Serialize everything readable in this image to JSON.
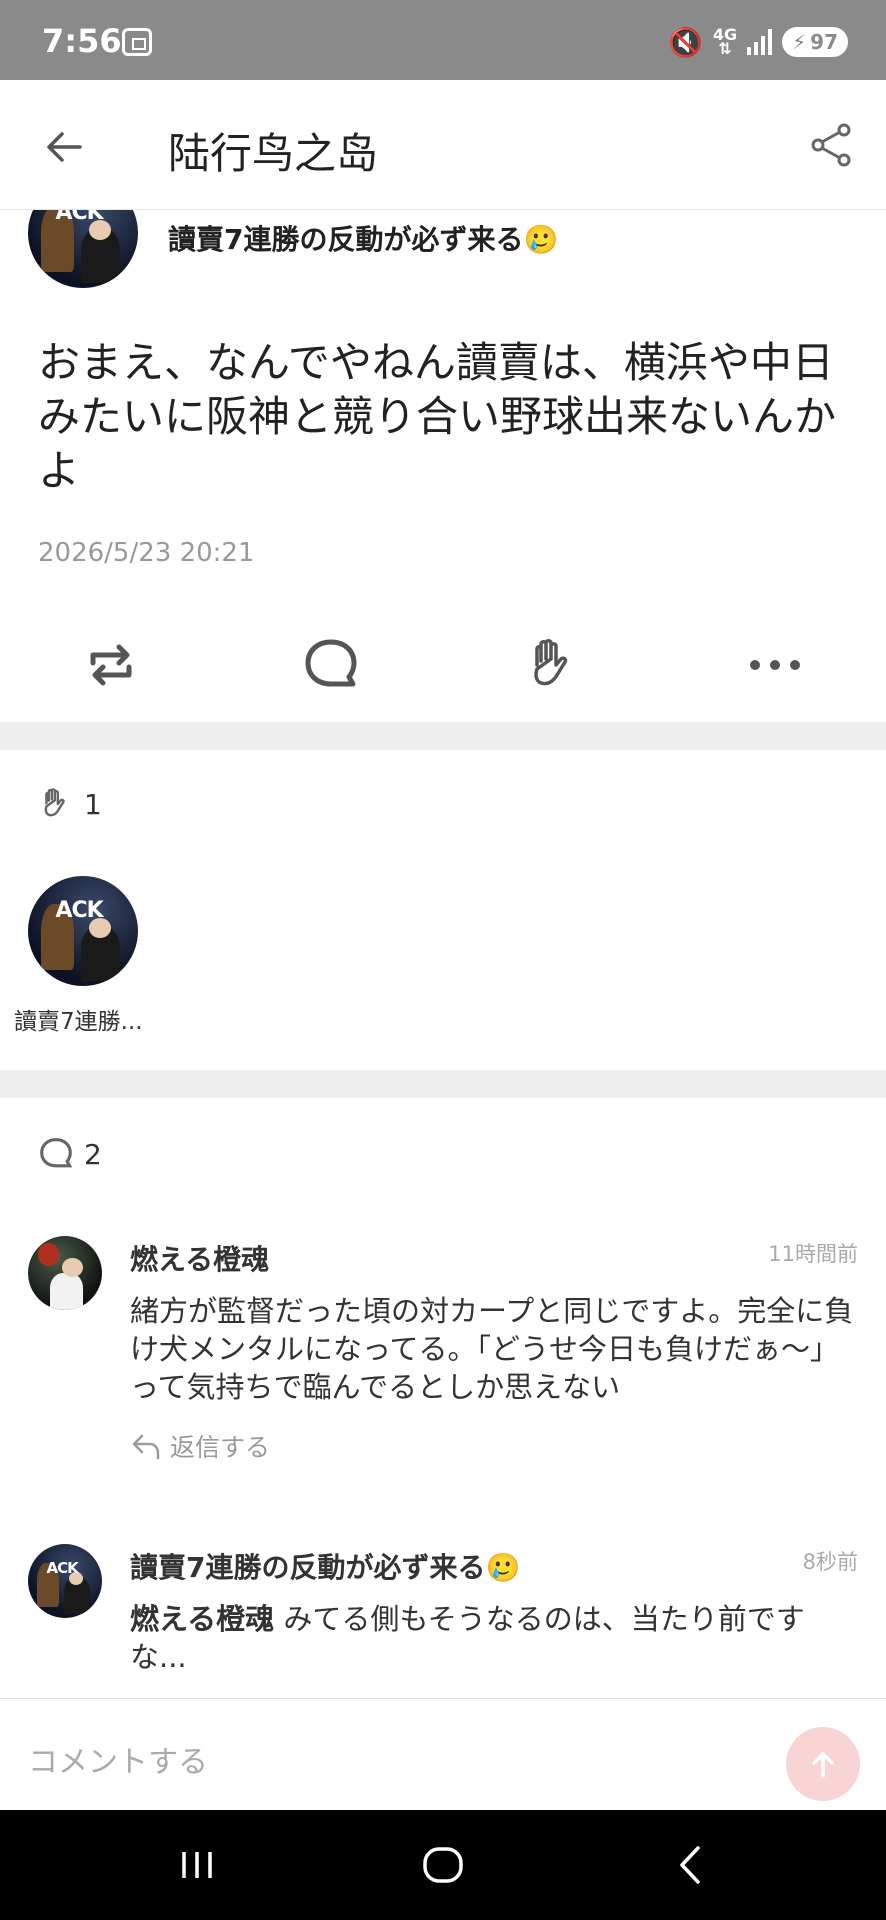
{
  "status_bar": {
    "time": "7:56",
    "network": "4G",
    "battery": "97"
  },
  "header": {
    "title": "陆行鸟之岛"
  },
  "post": {
    "author": "讀賣7連勝の反動が必ず来る🥲",
    "body": "おまえ、なんでやねん讀賣は、横浜や中日みたいに阪神と競り合い野球出来ないんかよ",
    "date": "2026/5/23 20:21"
  },
  "likes": {
    "count": "1",
    "likers": [
      {
        "name": "讀賣7連勝..."
      }
    ]
  },
  "comments": {
    "count": "2",
    "items": [
      {
        "author": "燃える橙魂",
        "time": "11時間前",
        "body": "緒方が監督だった頃の対カープと同じですよ。完全に負け犬メンタルになってる。「どうせ今日も負けだぁ～」って気持ちで臨んでるとしか思えない",
        "reply_label": "返信する"
      },
      {
        "author": "讀賣7連勝の反動が必ず来る🥲",
        "time": "8秒前",
        "mention": "燃える橙魂",
        "body": "みてる側もそうなるのは、当たり前ですな..."
      }
    ]
  },
  "comment_input": {
    "placeholder": "コメントする"
  },
  "colors": {
    "status_bar": "#8a8a8a",
    "separator": "#eeeeee",
    "send_button": "#f8d4d4",
    "nav_bar": "#000000"
  },
  "icons": [
    "back-arrow-icon",
    "share-icon",
    "repost-icon",
    "comment-icon",
    "clap-icon",
    "more-icon",
    "reply-icon",
    "send-icon"
  ]
}
